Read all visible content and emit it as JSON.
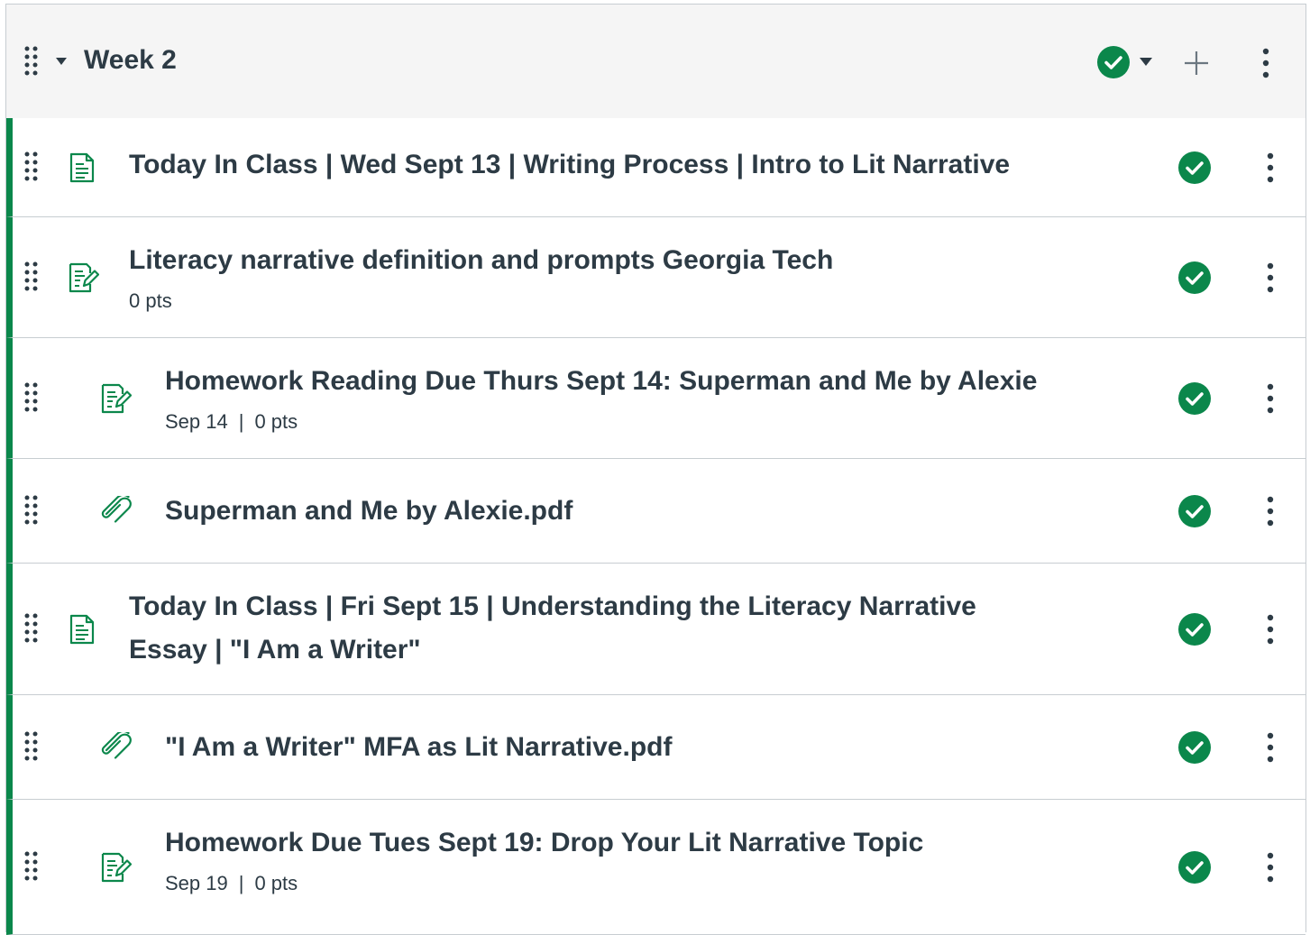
{
  "module": {
    "title": "Week 2",
    "accent_color": "#0b874b",
    "icons": {
      "drag": "drag-handle-icon",
      "collapse": "caret-down-icon",
      "publish": "check-circle-icon",
      "add": "plus-icon",
      "menu": "kebab-menu-icon"
    }
  },
  "items": [
    {
      "type_icon": "page-icon",
      "title_lines": [
        "Today In Class | Wed Sept 13 | Writing Process | Intro to Lit Narrative"
      ],
      "date": "",
      "points": ""
    },
    {
      "type_icon": "assignment-icon",
      "title_lines": [
        "Literacy narrative definition and prompts Georgia Tech"
      ],
      "date": "",
      "points": "0 pts"
    },
    {
      "type_icon": "assignment-icon",
      "title_lines": [
        "Homework Reading Due Thurs Sept 14: Superman and Me by Alexie"
      ],
      "date": "Sep 14",
      "points": "0 pts"
    },
    {
      "type_icon": "attachment-icon",
      "title_lines": [
        "Superman and Me by Alexie.pdf"
      ],
      "date": "",
      "points": ""
    },
    {
      "type_icon": "page-icon",
      "title_lines": [
        "Today In Class | Fri Sept 15 | Understanding the Literacy Narrative",
        "Essay | \"I Am a Writer\""
      ],
      "date": "",
      "points": ""
    },
    {
      "type_icon": "attachment-icon",
      "title_lines": [
        "\"I Am a Writer\" MFA as Lit Narrative.pdf"
      ],
      "date": "",
      "points": ""
    },
    {
      "type_icon": "assignment-icon",
      "title_lines": [
        "Homework Due Tues Sept 19: Drop Your Lit Narrative Topic"
      ],
      "date": "Sep 19",
      "points": "0 pts"
    }
  ]
}
